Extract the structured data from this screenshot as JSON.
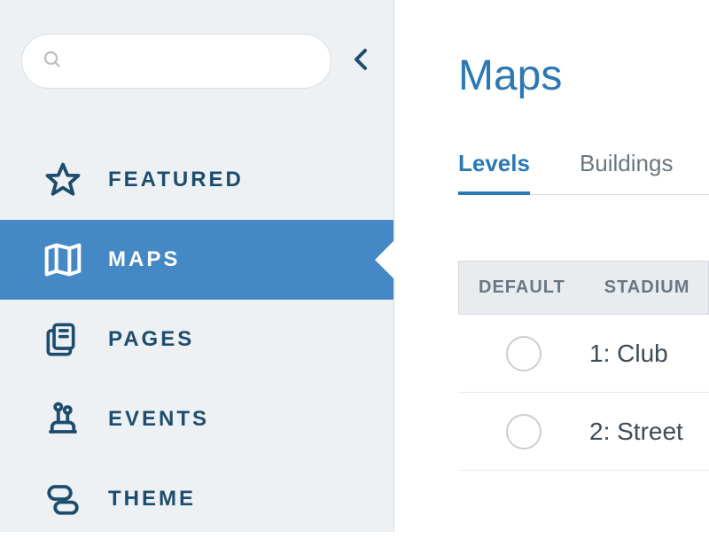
{
  "search": {
    "placeholder": ""
  },
  "sidebar": {
    "items": [
      {
        "label": "FEATURED"
      },
      {
        "label": "MAPS"
      },
      {
        "label": "PAGES"
      },
      {
        "label": "EVENTS"
      },
      {
        "label": "THEME"
      }
    ]
  },
  "page": {
    "title": "Maps"
  },
  "tabs": [
    {
      "label": "Levels"
    },
    {
      "label": "Buildings"
    }
  ],
  "table": {
    "headers": [
      {
        "label": "DEFAULT"
      },
      {
        "label": "STADIUM"
      }
    ],
    "rows": [
      {
        "label": "1: Club"
      },
      {
        "label": "2: Street"
      }
    ]
  }
}
